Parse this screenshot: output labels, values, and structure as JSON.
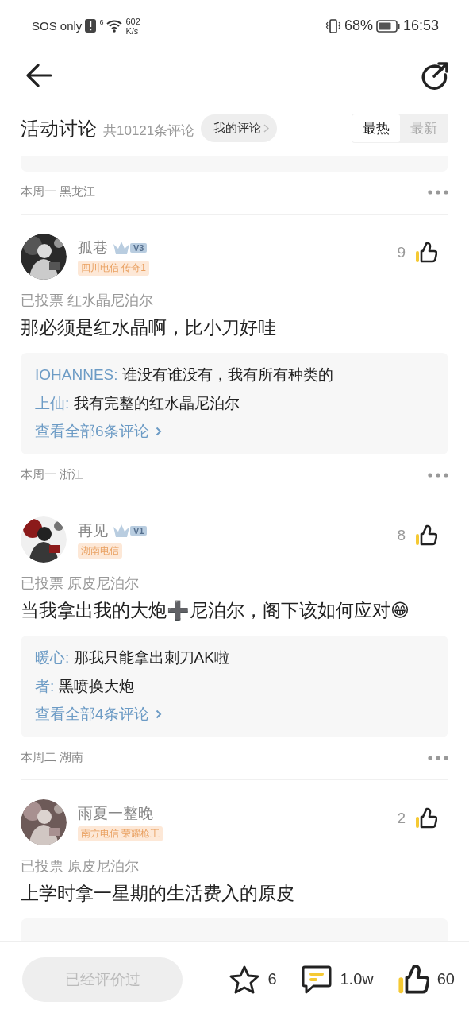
{
  "status_bar": {
    "carrier": "SOS only",
    "network": "6",
    "net_speed": "602",
    "net_unit": "K/s",
    "battery": "68%",
    "time": "16:53"
  },
  "header": {
    "title": "活动讨论",
    "count": "共10121条评论",
    "my_comments": "我的评论",
    "sort_tabs": [
      {
        "label": "最热",
        "selected": true
      },
      {
        "label": "最新",
        "selected": false
      }
    ]
  },
  "feed": [
    {
      "kind": "replies-edge"
    },
    {
      "kind": "meta",
      "text": "本周一 黑龙江"
    },
    {
      "kind": "comment",
      "user": "孤巷",
      "level": "V3",
      "tag": "四川电信 传奇1",
      "likes": "9",
      "vote": "已投票 红水晶尼泊尔",
      "body": "那必须是红水晶啊，比小刀好哇",
      "replies_box": true,
      "replies": [
        {
          "author": "IOHANNES:",
          "text": "谁没有谁没有，我有所有种类的"
        },
        {
          "author": "上仙:",
          "text": "我有完整的红水晶尼泊尔"
        }
      ],
      "more": "查看全部6条评论"
    },
    {
      "kind": "meta",
      "text": "本周一 浙江"
    },
    {
      "kind": "comment",
      "user": "再见",
      "level": "V1",
      "tag": "湖南电信",
      "likes": "8",
      "vote": "已投票 原皮尼泊尔",
      "body": "当我拿出我的大炮➕尼泊尔，阁下该如何应对😁",
      "replies_box": true,
      "replies": [
        {
          "author": "暖心:",
          "text": "那我只能拿出刺刀AK啦"
        },
        {
          "author": "者:",
          "text": "黑喷换大炮"
        }
      ],
      "more": "查看全部4条评论"
    },
    {
      "kind": "meta",
      "text": "本周二 湖南"
    },
    {
      "kind": "comment",
      "user": "雨夏一整晚",
      "tag": "南方电信 荣耀枪王",
      "likes": "2",
      "vote": "已投票 原皮尼泊尔",
      "body": "上学时拿一星期的生活费入的原皮",
      "replies_box": true
    }
  ],
  "bottom_bar": {
    "rate_button": "已经评价过",
    "rate_disabled": true,
    "favorites": "6",
    "comments": "1.0w",
    "likes": "60"
  }
}
